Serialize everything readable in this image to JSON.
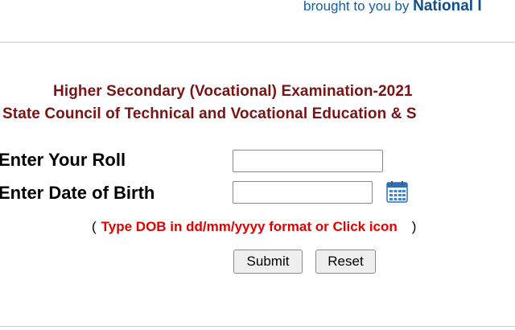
{
  "header": {
    "credit_prefix": "brought to you by ",
    "credit_org": "National I"
  },
  "titles": {
    "exam": "Higher Secondary (Vocational) Examination-2021",
    "council": "State Council of Technical and Vocational Education & S"
  },
  "form": {
    "roll_label": "Enter Your Roll",
    "roll_value": "",
    "dob_label": "Enter Date of Birth",
    "dob_value": "",
    "calendar_icon": "calendar-icon",
    "hint_open": "(",
    "hint_text": "Type DOB in dd/mm/yyyy format or Click icon",
    "hint_close": ")",
    "submit_label": "Submit",
    "reset_label": "Reset"
  },
  "colors": {
    "title": "#7a1414",
    "hint": "#e00000",
    "credit": "#1a5ea0"
  }
}
